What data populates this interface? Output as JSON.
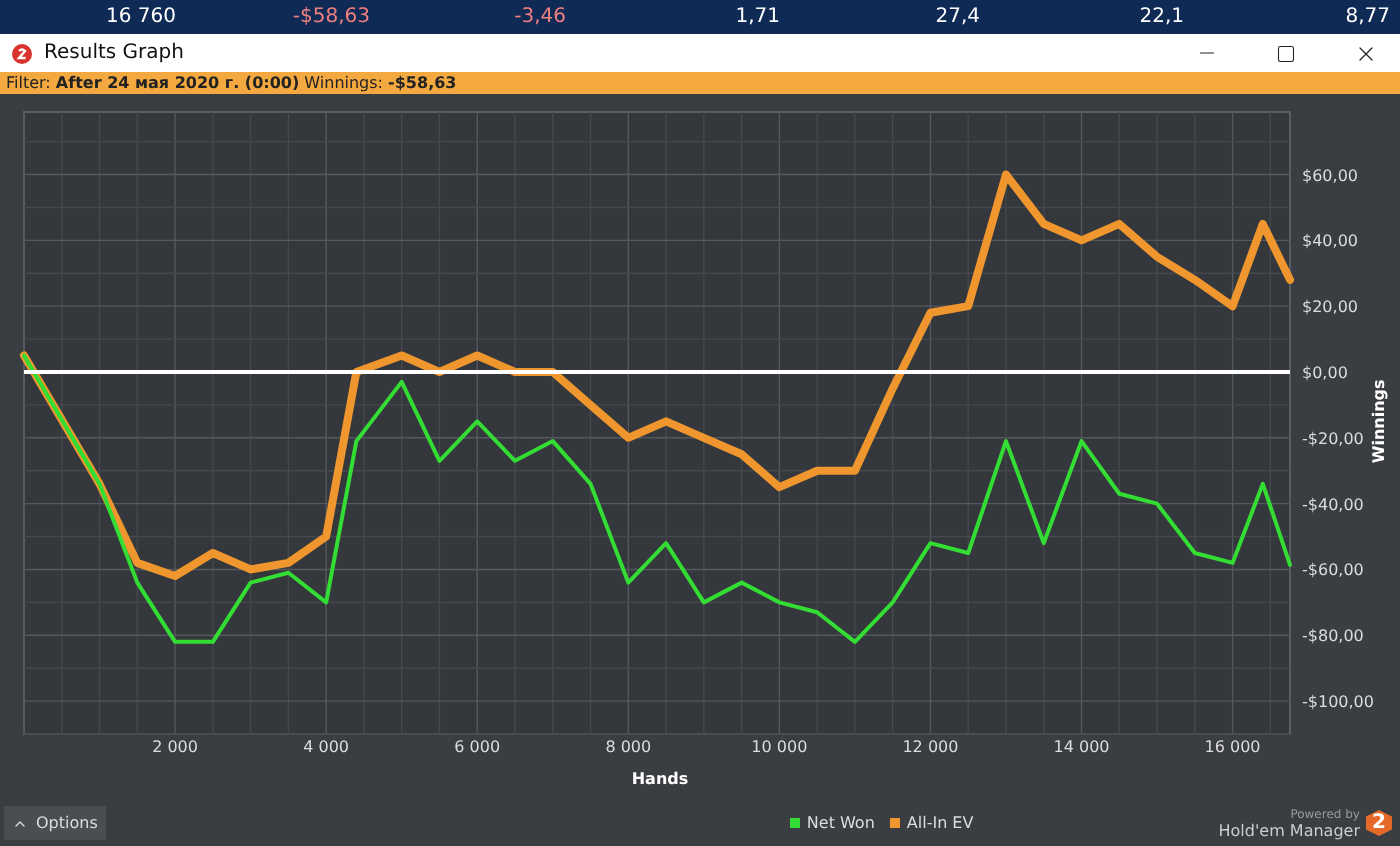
{
  "summary_row": [
    {
      "text": "16 760",
      "color": "#ffffff"
    },
    {
      "text": "-$58,63",
      "color": "#f08080"
    },
    {
      "text": "-3,46",
      "color": "#f08080"
    },
    {
      "text": "1,71",
      "color": "#ffffff"
    },
    {
      "text": "27,4",
      "color": "#ffffff"
    },
    {
      "text": "22,1",
      "color": "#ffffff"
    },
    {
      "text": "8,77",
      "color": "#ffffff"
    }
  ],
  "window": {
    "title": "Results Graph"
  },
  "filter_bar": {
    "text": "Filter: **After 24 мая 2020 г. (0:00)** Winnings: **-$58,63**"
  },
  "graph": {
    "chart_data": {
      "type": "line",
      "grid": true,
      "xlabel": "Hands",
      "ylabel": "Winnings",
      "xlim": [
        0,
        16760
      ],
      "ylim": [
        -110,
        79
      ],
      "xticks": [
        {
          "value": 2000,
          "label": "2 000"
        },
        {
          "value": 4000,
          "label": "4 000"
        },
        {
          "value": 6000,
          "label": "6 000"
        },
        {
          "value": 8000,
          "label": "8 000"
        },
        {
          "value": 10000,
          "label": "10 000"
        },
        {
          "value": 12000,
          "label": "12 000"
        },
        {
          "value": 14000,
          "label": "14 000"
        },
        {
          "value": 16000,
          "label": "16 000"
        }
      ],
      "yticks": [
        {
          "value": 60,
          "label": "$60,00"
        },
        {
          "value": 40,
          "label": "$40,00"
        },
        {
          "value": 20,
          "label": "$20,00"
        },
        {
          "value": 0,
          "label": "$0,00"
        },
        {
          "value": -20,
          "label": "-$20,00"
        },
        {
          "value": -40,
          "label": "-$40,00"
        },
        {
          "value": -60,
          "label": "-$60,00"
        },
        {
          "value": -80,
          "label": "-$80,00"
        },
        {
          "value": -100,
          "label": "-$100,00"
        }
      ],
      "x": [
        0,
        1000,
        1500,
        2000,
        2500,
        3000,
        3500,
        4000,
        4400,
        5000,
        5500,
        6000,
        6500,
        7000,
        7500,
        8000,
        8500,
        9000,
        9500,
        10000,
        10500,
        11000,
        11500,
        12000,
        12500,
        13000,
        13500,
        14000,
        14500,
        15000,
        15500,
        16000,
        16400,
        16760
      ],
      "series": [
        {
          "name": "Net Won",
          "color": "#33dd33",
          "values": [
            5,
            -34,
            -64,
            -82,
            -82,
            -64,
            -61,
            -70,
            -21,
            -3,
            -27,
            -15,
            -27,
            -21,
            -34,
            -64,
            -52,
            -70,
            -64,
            -70,
            -73,
            -82,
            -70,
            -52,
            -55,
            -21,
            -52,
            -21,
            -37,
            -40,
            -55,
            -58,
            -34,
            -58.6
          ]
        },
        {
          "name": "All-In EV",
          "color": "#f0962e",
          "values": [
            5,
            -34,
            -58,
            -62,
            -55,
            -60,
            -58,
            -50,
            0,
            5,
            0,
            5,
            0,
            0,
            -10,
            -20,
            -15,
            -20,
            -25,
            -35,
            -30,
            -30,
            -5,
            18,
            20,
            60,
            45,
            40,
            45,
            35,
            28,
            20,
            45,
            28
          ]
        }
      ]
    }
  },
  "footer": {
    "options_label": "Options",
    "powered_by": "Powered by",
    "brand": "Hold'em Manager",
    "logo_text": "2"
  }
}
